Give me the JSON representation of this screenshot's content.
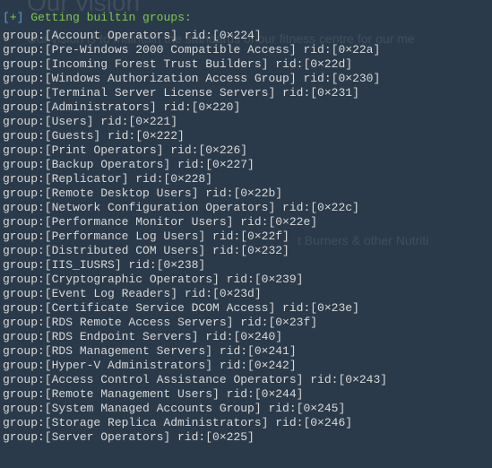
{
  "background": {
    "title": "Our vision",
    "line1": "Our vision is to maintain the standards of our fitness centre for our me",
    "line2": "t Burners & other Nutriti"
  },
  "header": {
    "open_bracket": "[",
    "symbol": "+",
    "close_bracket": "]",
    "text": " Getting builtin groups:"
  },
  "groups": [
    {
      "name": "Account Operators",
      "rid": "0×224"
    },
    {
      "name": "Pre-Windows 2000 Compatible Access",
      "rid": "0×22a"
    },
    {
      "name": "Incoming Forest Trust Builders",
      "rid": "0×22d"
    },
    {
      "name": "Windows Authorization Access Group",
      "rid": "0×230"
    },
    {
      "name": "Terminal Server License Servers",
      "rid": "0×231"
    },
    {
      "name": "Administrators",
      "rid": "0×220"
    },
    {
      "name": "Users",
      "rid": "0×221"
    },
    {
      "name": "Guests",
      "rid": "0×222"
    },
    {
      "name": "Print Operators",
      "rid": "0×226"
    },
    {
      "name": "Backup Operators",
      "rid": "0×227"
    },
    {
      "name": "Replicator",
      "rid": "0×228"
    },
    {
      "name": "Remote Desktop Users",
      "rid": "0×22b"
    },
    {
      "name": "Network Configuration Operators",
      "rid": "0×22c"
    },
    {
      "name": "Performance Monitor Users",
      "rid": "0×22e"
    },
    {
      "name": "Performance Log Users",
      "rid": "0×22f"
    },
    {
      "name": "Distributed COM Users",
      "rid": "0×232"
    },
    {
      "name": "IIS_IUSRS",
      "rid": "0×238"
    },
    {
      "name": "Cryptographic Operators",
      "rid": "0×239"
    },
    {
      "name": "Event Log Readers",
      "rid": "0×23d"
    },
    {
      "name": "Certificate Service DCOM Access",
      "rid": "0×23e"
    },
    {
      "name": "RDS Remote Access Servers",
      "rid": "0×23f"
    },
    {
      "name": "RDS Endpoint Servers",
      "rid": "0×240"
    },
    {
      "name": "RDS Management Servers",
      "rid": "0×241"
    },
    {
      "name": "Hyper-V Administrators",
      "rid": "0×242"
    },
    {
      "name": "Access Control Assistance Operators",
      "rid": "0×243"
    },
    {
      "name": "Remote Management Users",
      "rid": "0×244"
    },
    {
      "name": "System Managed Accounts Group",
      "rid": "0×245"
    },
    {
      "name": "Storage Replica Administrators",
      "rid": "0×246"
    },
    {
      "name": "Server Operators",
      "rid": "0×225"
    }
  ]
}
